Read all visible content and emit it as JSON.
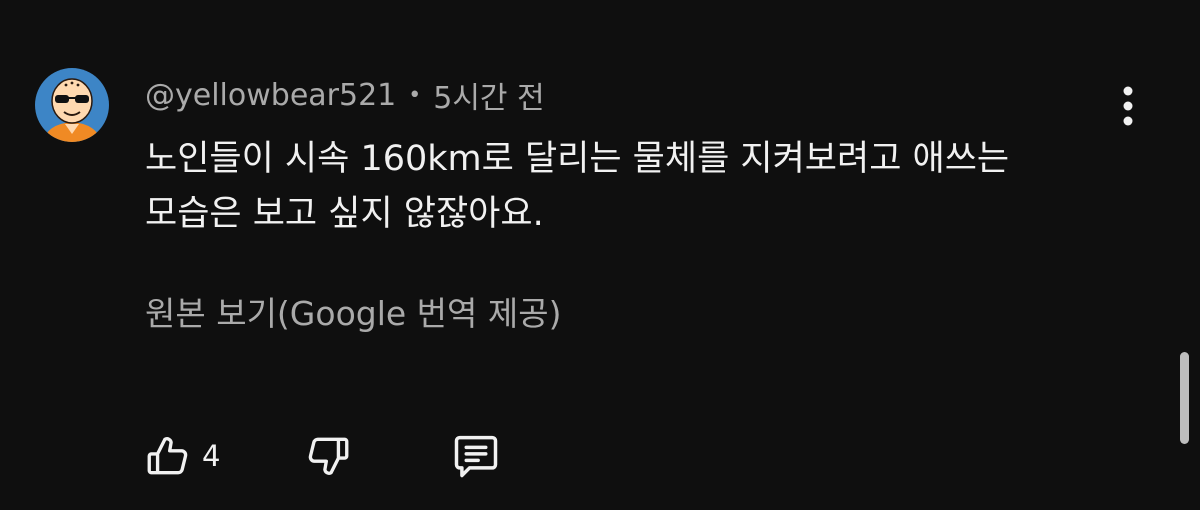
{
  "comment": {
    "author": "@yellowbear521",
    "separator": "•",
    "time": "5시간 전",
    "lines": [
      "노인들이 시속 160km로 달리는 물체를 지켜보려고 애쓰는",
      "모습은 보고 싶지 않잖아요."
    ],
    "translate_link": "원본 보기(Google 번역 제공)",
    "like_count": "4"
  },
  "icons": {
    "avatar": "avatar-cartoon-bald-sunglasses",
    "more": "more-vertical-icon",
    "like": "thumb-up-icon",
    "dislike": "thumb-down-icon",
    "reply": "comment-reply-icon"
  },
  "colors": {
    "background": "#0f0f0f",
    "primary_text": "#f1f1f1",
    "secondary_text": "#aaaaaa",
    "avatar_bg": "#3d85c6",
    "scrollbar": "#bdbdbd"
  }
}
